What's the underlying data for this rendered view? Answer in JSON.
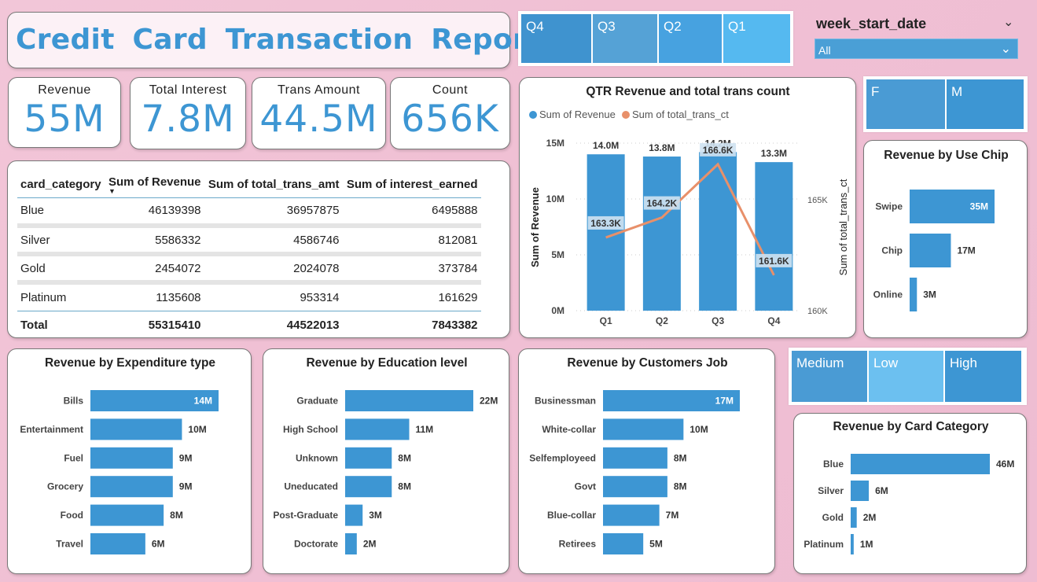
{
  "title": "Credit  Card  Transaction  Report",
  "quarter_slicer": [
    "Q4",
    "Q3",
    "Q2",
    "Q1"
  ],
  "gender_slicer": [
    "F",
    "M"
  ],
  "income_slicer": [
    "Medium",
    "Low",
    "High"
  ],
  "week_filter": {
    "label": "week_start_date",
    "value": "All"
  },
  "kpis": {
    "revenue": {
      "label": "Revenue",
      "value": "55M"
    },
    "interest": {
      "label": "Total Interest",
      "value": "7.8M"
    },
    "trans_amount": {
      "label": "Trans Amount",
      "value": "44.5M"
    },
    "count": {
      "label": "Count",
      "value": "656K"
    }
  },
  "table": {
    "columns": [
      "card_category",
      "Sum of Revenue",
      "Sum of total_trans_amt",
      "Sum of interest_earned"
    ],
    "rows": [
      [
        "Blue",
        "46139398",
        "36957875",
        "6495888"
      ],
      [
        "Silver",
        "5586332",
        "4586746",
        "812081"
      ],
      [
        "Gold",
        "2454072",
        "2024078",
        "373784"
      ],
      [
        "Platinum",
        "1135608",
        "953314",
        "161629"
      ]
    ],
    "total": [
      "Total",
      "55315410",
      "44522013",
      "7843382"
    ]
  },
  "colors": {
    "bar": "#3d96d3",
    "line": "#e8906a",
    "title": "#3d96d3"
  },
  "chart_data": [
    {
      "type": "bar",
      "title": "QTR Revenue and total trans count",
      "categories": [
        "Q1",
        "Q2",
        "Q3",
        "Q4"
      ],
      "series": [
        {
          "name": "Sum of Revenue",
          "type": "bar",
          "values": [
            14000000,
            13800000,
            14200000,
            13300000
          ],
          "labels": [
            "14.0M",
            "13.8M",
            "14.2M",
            "13.3M"
          ]
        },
        {
          "name": "Sum of total_trans_ct",
          "type": "line",
          "values": [
            163300,
            164200,
            166600,
            161600
          ],
          "labels": [
            "163.3K",
            "164.2K",
            "166.6K",
            "161.6K"
          ]
        }
      ],
      "ylabel": "Sum of Revenue",
      "y2label": "Sum of total_trans_ct",
      "yticks": [
        "0M",
        "5M",
        "10M",
        "15M"
      ],
      "ylim": [
        0,
        15000000
      ],
      "y2ticks": [
        "160K",
        "165K"
      ],
      "y2lim": [
        160000,
        165000
      ],
      "legend": "top-left"
    },
    {
      "type": "bar",
      "orientation": "horizontal",
      "title": "Revenue by Use Chip",
      "categories": [
        "Swipe",
        "Chip",
        "Online"
      ],
      "values": [
        35,
        17,
        3
      ],
      "labels": [
        "35M",
        "17M",
        "3M"
      ]
    },
    {
      "type": "bar",
      "orientation": "horizontal",
      "title": "Revenue by Expenditure type",
      "categories": [
        "Bills",
        "Entertainment",
        "Fuel",
        "Grocery",
        "Food",
        "Travel"
      ],
      "values": [
        14,
        10,
        9,
        9,
        8,
        6
      ],
      "labels": [
        "14M",
        "10M",
        "9M",
        "9M",
        "8M",
        "6M"
      ]
    },
    {
      "type": "bar",
      "orientation": "horizontal",
      "title": "Revenue by Education level",
      "categories": [
        "Graduate",
        "High School",
        "Unknown",
        "Uneducated",
        "Post-Graduate",
        "Doctorate"
      ],
      "values": [
        22,
        11,
        8,
        8,
        3,
        2
      ],
      "labels": [
        "22M",
        "11M",
        "8M",
        "8M",
        "3M",
        "2M"
      ]
    },
    {
      "type": "bar",
      "orientation": "horizontal",
      "title": "Revenue by Customers Job",
      "categories": [
        "Businessman",
        "White-collar",
        "Selfemployeed",
        "Govt",
        "Blue-collar",
        "Retirees"
      ],
      "values": [
        17,
        10,
        8,
        8,
        7,
        5
      ],
      "labels": [
        "17M",
        "10M",
        "8M",
        "8M",
        "7M",
        "5M"
      ]
    },
    {
      "type": "bar",
      "orientation": "horizontal",
      "title": "Revenue by Card Category",
      "categories": [
        "Blue",
        "Silver",
        "Gold",
        "Platinum"
      ],
      "values": [
        46,
        6,
        2,
        1
      ],
      "labels": [
        "46M",
        "6M",
        "2M",
        "1M"
      ]
    }
  ]
}
